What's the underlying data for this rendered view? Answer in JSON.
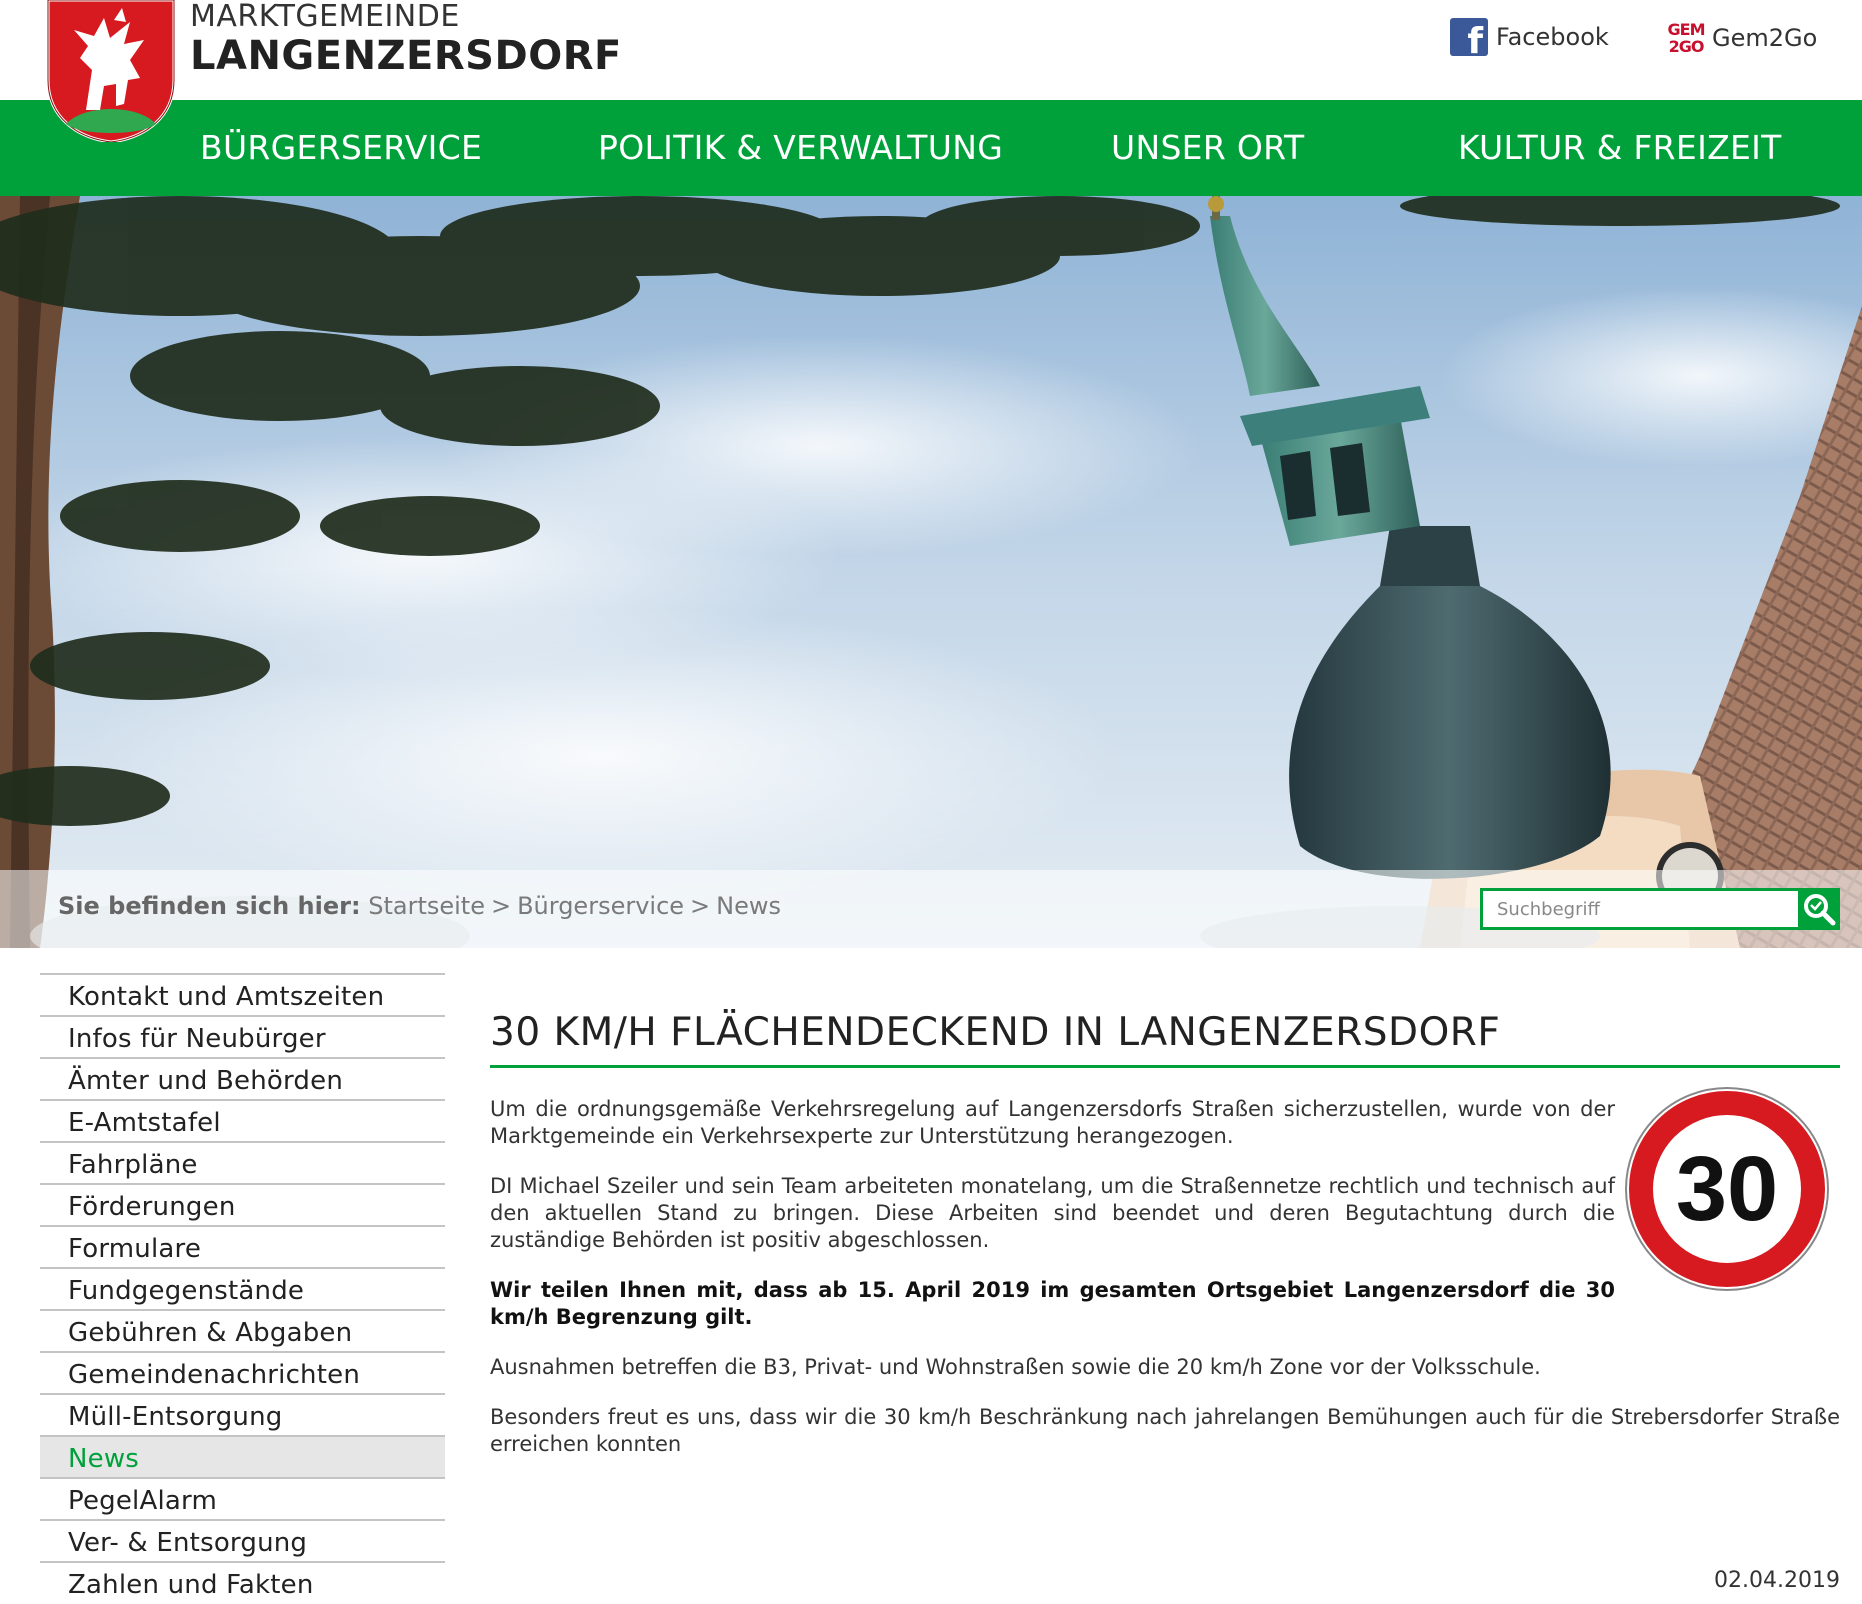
{
  "brand": {
    "top": "MARKTGEMEINDE",
    "main": "LANGENZERSDORF"
  },
  "toplinks": {
    "facebook": "Facebook",
    "gem2go": "Gem2Go",
    "gem2go_badge_top": "GEM",
    "gem2go_badge_bottom": "2GO"
  },
  "nav": {
    "items": [
      "BÜRGERSERVICE",
      "POLITIK & VERWALTUNG",
      "UNSER ORT",
      "KULTUR & FREIZEIT"
    ]
  },
  "breadcrumb": {
    "lead": "Sie befinden sich hier:",
    "items": [
      "Startseite",
      "Bürgerservice",
      "News"
    ],
    "separator": ">"
  },
  "search": {
    "placeholder": "Suchbegriff"
  },
  "sidebar": {
    "items": [
      "Kontakt und Amtszeiten",
      "Infos für Neubürger",
      "Ämter und Behörden",
      "E-Amtstafel",
      "Fahrpläne",
      "Förderungen",
      "Formulare",
      "Fundgegenstände",
      "Gebühren & Abgaben",
      "Gemeindenachrichten",
      "Müll-Entsorgung",
      "News",
      "PegelAlarm",
      "Ver- & Entsorgung",
      "Zahlen und Fakten"
    ],
    "active": "News"
  },
  "article": {
    "title": "30 KM/H FLÄCHENDECKEND IN LANGENZERSDORF",
    "sign_number": "30",
    "p1": "Um die ordnungsgemäße Verkehrsregelung auf Langenzersdorfs Straßen sicherzustellen, wurde von der Marktgemeinde ein Verkehrsexperte zur Unterstützung herangezogen.",
    "p2": "DI Michael Szeiler und sein Team arbeiteten monatelang, um die Straßennetze rechtlich und technisch auf den aktuellen Stand zu bringen. Diese Arbeiten sind beendet und deren Begutachtung durch die zuständige Behörden ist positiv abgeschlossen.",
    "p3": "Wir teilen Ihnen mit, dass ab 15. April 2019 im gesamten Ortsgebiet Langenzersdorf die 30 km/h Begrenzung gilt.",
    "p4": "Ausnahmen betreffen die B3, Privat- und Wohnstraßen sowie die 20 km/h Zone vor der Volksschule.",
    "p5": "Besonders freut es uns, dass wir die 30 km/h Beschränkung nach jahrelangen Bemühungen auch für die Strebersdorfer Straße erreichen konnten",
    "date": "02.04.2019"
  },
  "colors": {
    "brand_green": "#00a13a",
    "crest_red": "#d71920",
    "facebook_blue": "#3b5998",
    "gem2go_red": "#c8102e",
    "sign_red": "#d71920"
  }
}
